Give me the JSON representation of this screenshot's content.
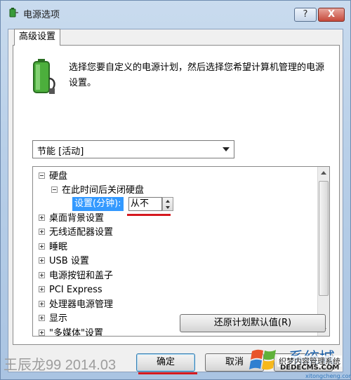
{
  "window": {
    "title": "电源选项",
    "help_label": "?",
    "close_label": "X"
  },
  "tab": {
    "label": "高级设置"
  },
  "description": "选择您要自定义的电源计划，然后选择您希望计算机管理的电源设置。",
  "plan_select": {
    "value": "节能 [活动]"
  },
  "tree": {
    "items": [
      {
        "label": "硬盘",
        "state": "expanded"
      },
      {
        "label": "在此时间后关闭硬盘",
        "state": "expanded"
      },
      {
        "setting_label": "设置(分钟):",
        "value": "从不"
      },
      {
        "label": "桌面背景设置",
        "state": "collapsed"
      },
      {
        "label": "无线适配器设置",
        "state": "collapsed"
      },
      {
        "label": "睡眠",
        "state": "collapsed"
      },
      {
        "label": "USB 设置",
        "state": "collapsed"
      },
      {
        "label": "电源按钮和盖子",
        "state": "collapsed"
      },
      {
        "label": "PCI Express",
        "state": "collapsed"
      },
      {
        "label": "处理器电源管理",
        "state": "collapsed"
      },
      {
        "label": "显示",
        "state": "collapsed"
      },
      {
        "label": "\"多媒体\"设置",
        "state": "collapsed"
      }
    ]
  },
  "buttons": {
    "restore": "还原计划默认值(R)",
    "ok": "确定",
    "cancel": "取消",
    "apply": "应用"
  },
  "overlay": {
    "watermark": "王辰龙99 2014.03",
    "logo_text": "系统城",
    "logo_subtitle": "织梦内容管理系统",
    "logo_url1": "DEDECMS.COM",
    "logo_url2": "xitongcheng.com"
  },
  "colors": {
    "highlight": "#3399ff",
    "annotation_red": "#d6191f",
    "window_frame": "#b8cfe8"
  }
}
